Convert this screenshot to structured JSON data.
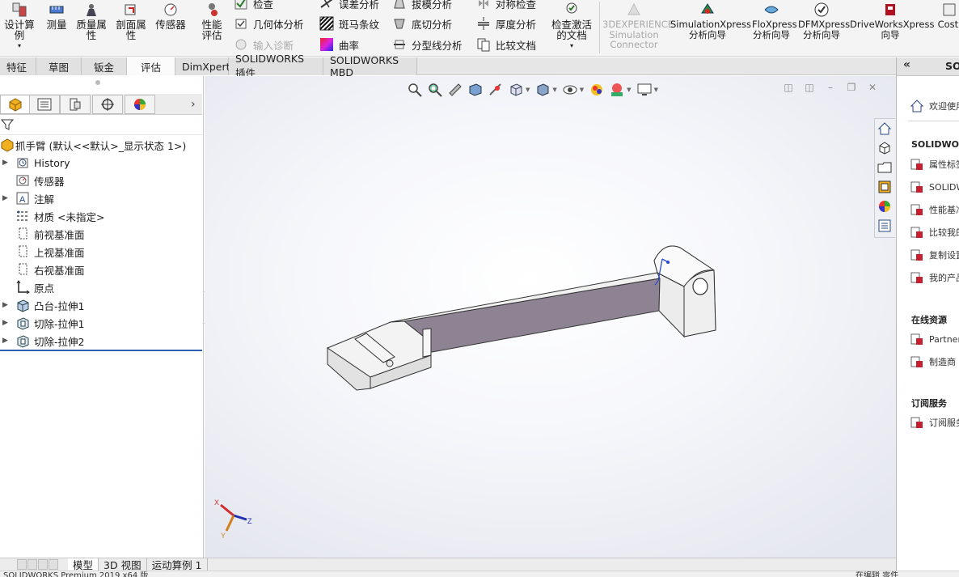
{
  "ribbon": {
    "design_study": "设计算例",
    "measure": "测量",
    "mass_properties": "质量属性",
    "section_properties": "剖面属性",
    "sensors": "传感器",
    "performance_eval": "性能评估",
    "check": "检查",
    "geometry_analysis": "几何体分析",
    "import_diagnostics": "输入诊断",
    "deviation_analysis": "误差分析",
    "zebra_stripes": "斑马条纹",
    "curvature": "曲率",
    "draft_analysis": "拔模分析",
    "undercut_analysis": "底切分析",
    "parting_line_analysis": "分型线分析",
    "symmetry_check": "对称检查",
    "thickness_analysis": "厚度分析",
    "compare_documents": "比较文档",
    "check_active_doc": "检查激活的文档",
    "experience_connector": "3DEXPERIENCE Simulation Connector",
    "simulation_xpress": "SimulationXpress 分析向导",
    "floxpress": "FloXpress 分析向导",
    "dfmxpress": "DFMXpress 分析向导",
    "driveworks": "DriveWorksXpress 向导",
    "costing": "Costi"
  },
  "tabs": [
    {
      "label": "特征",
      "active": false
    },
    {
      "label": "草图",
      "active": false
    },
    {
      "label": "钣金",
      "active": false
    },
    {
      "label": "评估",
      "active": true
    },
    {
      "label": "DimXpert",
      "active": false
    },
    {
      "label": "SOLIDWORKS 插件",
      "active": false
    },
    {
      "label": "SOLIDWORKS MBD",
      "active": false
    }
  ],
  "tree": {
    "root": "抓手臂 (默认<<默认>_显示状态 1>)",
    "items": [
      {
        "label": "History",
        "expandable": true,
        "icon": "history-icon"
      },
      {
        "label": "传感器",
        "expandable": false,
        "icon": "sensor-icon"
      },
      {
        "label": "注解",
        "expandable": true,
        "icon": "annotation-icon"
      },
      {
        "label": "材质 <未指定>",
        "expandable": false,
        "icon": "material-icon"
      },
      {
        "label": "前视基准面",
        "expandable": false,
        "icon": "plane-icon"
      },
      {
        "label": "上视基准面",
        "expandable": false,
        "icon": "plane-icon"
      },
      {
        "label": "右视基准面",
        "expandable": false,
        "icon": "plane-icon"
      },
      {
        "label": "原点",
        "expandable": false,
        "icon": "origin-icon"
      },
      {
        "label": "凸台-拉伸1",
        "expandable": true,
        "icon": "boss-extrude-icon"
      },
      {
        "label": "切除-拉伸1",
        "expandable": true,
        "icon": "cut-extrude-icon"
      },
      {
        "label": "切除-拉伸2",
        "expandable": true,
        "icon": "cut-extrude-icon"
      }
    ]
  },
  "bottom_tabs": [
    {
      "label": "模型",
      "active": true
    },
    {
      "label": "3D 视图",
      "active": false
    },
    {
      "label": "运动算例 1",
      "active": false
    }
  ],
  "statusbar": {
    "left": "SOLIDWORKS Premium 2019 x64 版",
    "right": "在编辑 零件"
  },
  "taskpane": {
    "title": "SOL",
    "welcome": "欢迎使用",
    "section_solidworks": "SOLIDWORI",
    "items_solidworks": [
      "属性标签",
      "SOLIDW",
      "性能基准",
      "比较我的",
      "复制设置",
      "我的产品"
    ],
    "section_online": "在线资源",
    "items_online": [
      "Partner",
      "制造商"
    ],
    "section_subscription": "订阅服务",
    "items_subscription": [
      "订阅服务"
    ]
  },
  "triad": {
    "x": "X",
    "y": "Y",
    "z": "Z"
  },
  "colors": {
    "part_top": "#f1f1f1",
    "part_side": "#8e8392",
    "part_end": "#e3e3e3",
    "accent_blue": "#2d5fb0",
    "triad_x": "#d03030",
    "triad_y": "#d08020",
    "triad_z": "#2030b0"
  }
}
